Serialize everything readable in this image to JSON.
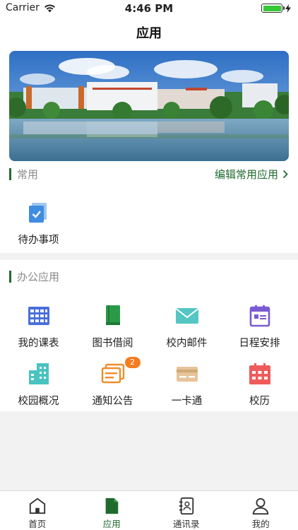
{
  "status_bar": {
    "carrier": "Carrier",
    "time": "4:46 PM"
  },
  "nav": {
    "title": "应用"
  },
  "common": {
    "title": "常用",
    "edit_link": "编辑常用应用",
    "items": [
      {
        "label": "待办事项",
        "icon": "todo-icon"
      }
    ]
  },
  "office": {
    "title": "办公应用",
    "items": [
      {
        "label": "我的课表",
        "icon": "timetable-icon",
        "color": "#4a6fd8"
      },
      {
        "label": "图书借阅",
        "icon": "book-icon",
        "color": "#2a9a48"
      },
      {
        "label": "校内邮件",
        "icon": "mail-icon",
        "color": "#55c6c4"
      },
      {
        "label": "日程安排",
        "icon": "calendar-icon",
        "color": "#7a5bd3"
      },
      {
        "label": "校园概况",
        "icon": "building-icon",
        "color": "#4ac3c0"
      },
      {
        "label": "通知公告",
        "icon": "notice-icon",
        "color": "#f08c2b",
        "badge": "2"
      },
      {
        "label": "一卡通",
        "icon": "card-icon",
        "color": "#e0b98a"
      },
      {
        "label": "校历",
        "icon": "school-calendar-icon",
        "color": "#ef5b5b"
      }
    ]
  },
  "tabs": [
    {
      "label": "首页",
      "icon": "home-icon"
    },
    {
      "label": "应用",
      "icon": "apps-icon",
      "active": true
    },
    {
      "label": "通讯录",
      "icon": "contacts-icon"
    },
    {
      "label": "我的",
      "icon": "profile-icon"
    }
  ],
  "colors": {
    "accent": "#1f6b2e",
    "badge": "#f57c1f"
  }
}
